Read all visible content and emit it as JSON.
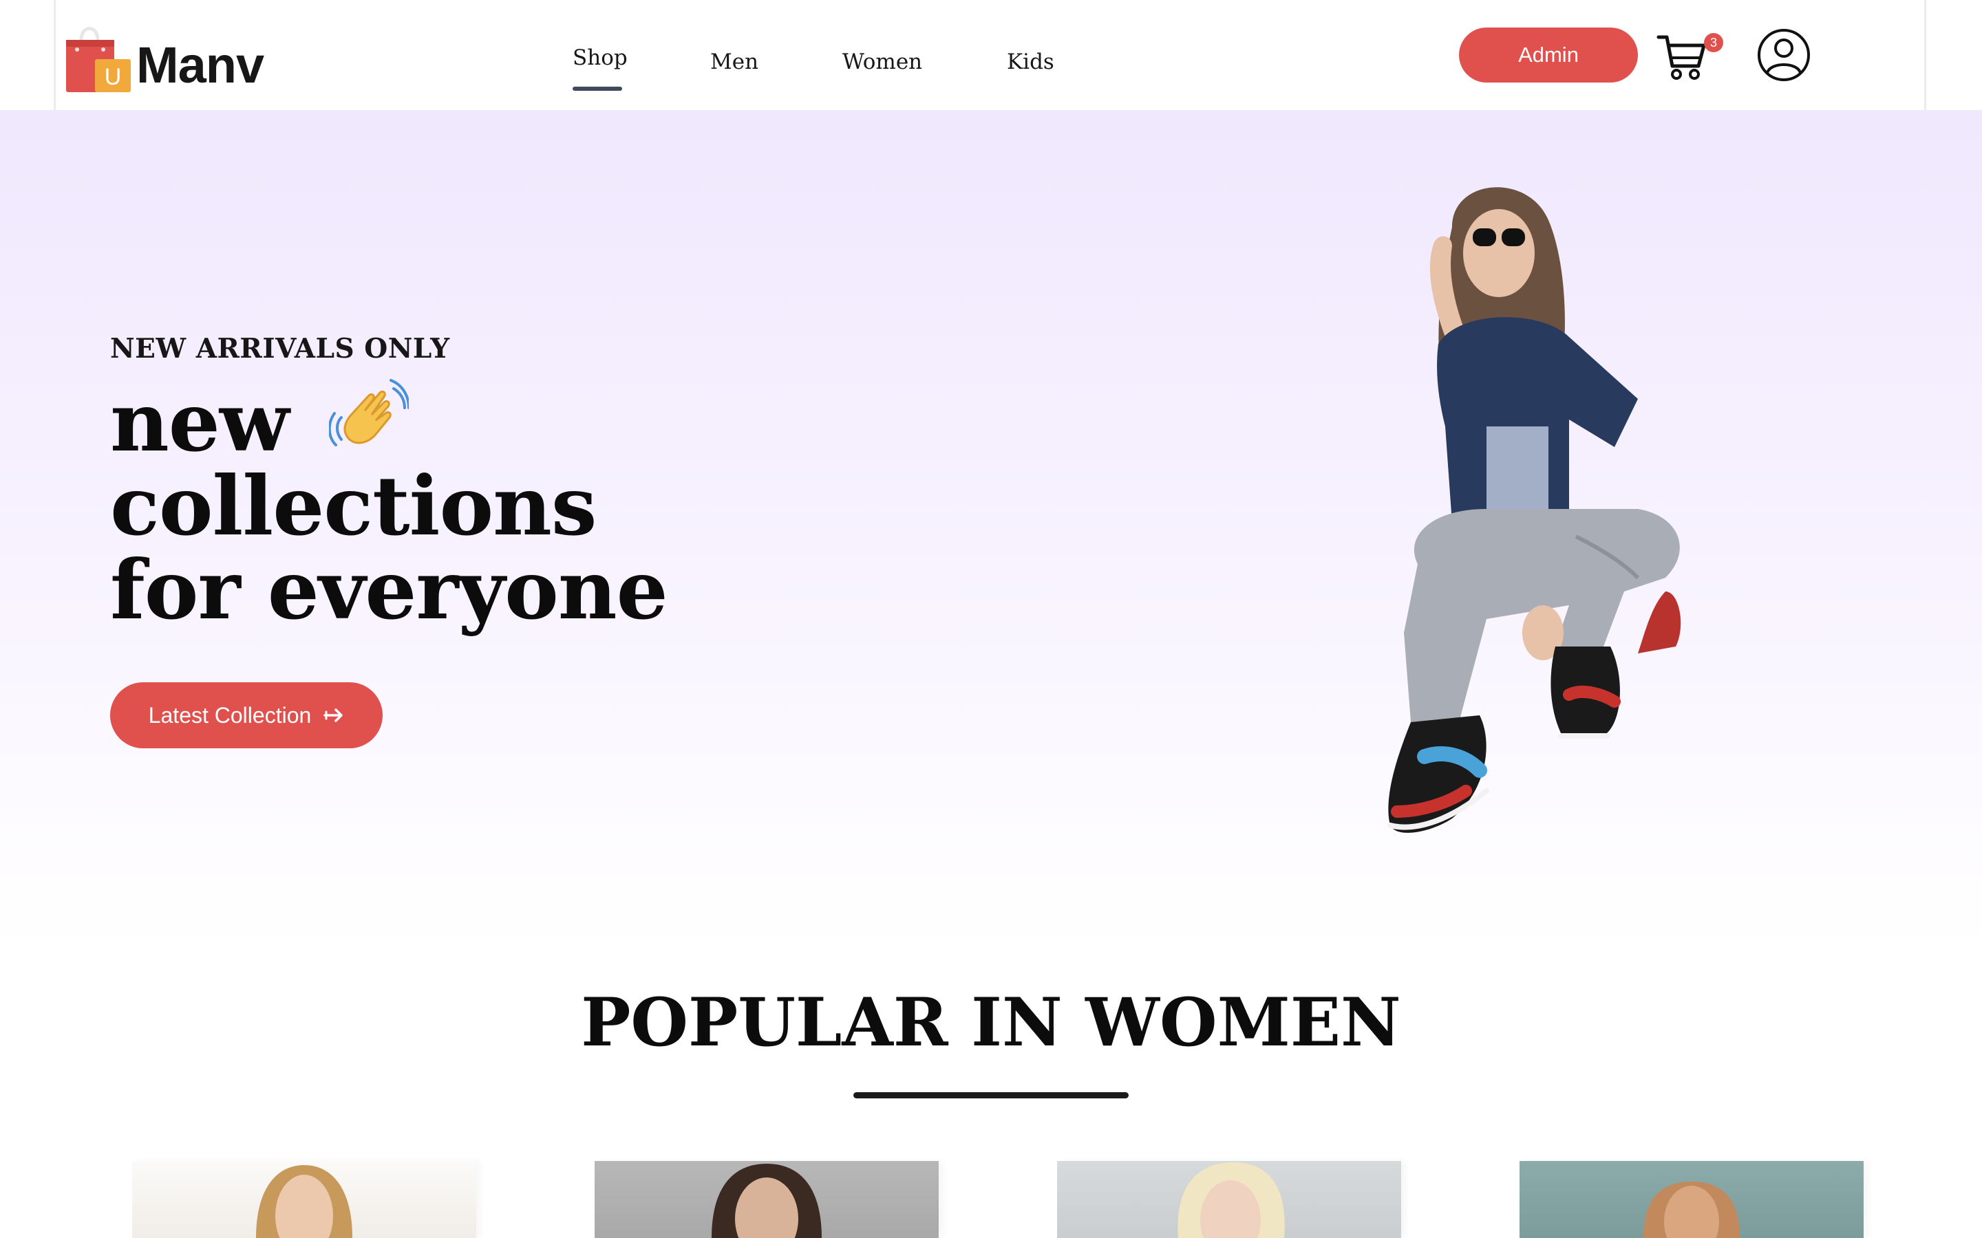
{
  "brand": {
    "logo_letter": "U",
    "name": "Manv",
    "colors": {
      "accent": "#e0504d",
      "bag_red": "#e0504d",
      "bag_orange": "#f2a93b",
      "hero_bg": "#f0e8fd",
      "text": "#171717"
    }
  },
  "nav": {
    "links": [
      {
        "label": "Shop",
        "active": true
      },
      {
        "label": "Men",
        "active": false
      },
      {
        "label": "Women",
        "active": false
      },
      {
        "label": "Kids",
        "active": false
      }
    ]
  },
  "header_actions": {
    "admin_label": "Admin",
    "cart_icon": "cart-icon",
    "cart_count": "3",
    "user_icon": "user-circle-icon"
  },
  "hero": {
    "eyebrow": "NEW ARRIVALS ONLY",
    "title_line1": "new",
    "title_line2": "collections",
    "title_line3": "for everyone",
    "wave_icon": "waving-hand-icon",
    "cta_label": "Latest Collection",
    "cta_icon": "arrow-right-icon",
    "image": "hero-model-image"
  },
  "popular": {
    "title": "POPULAR IN WOMEN",
    "products": [
      {
        "image": "product-image-1"
      },
      {
        "image": "product-image-2"
      },
      {
        "image": "product-image-3"
      },
      {
        "image": "product-image-4"
      }
    ]
  }
}
